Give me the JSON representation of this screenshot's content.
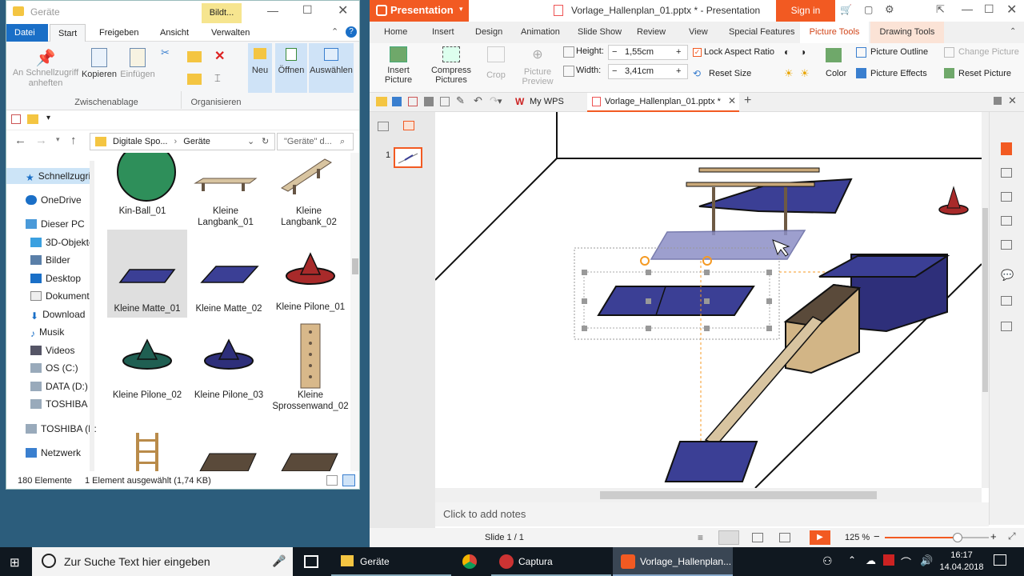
{
  "explorer": {
    "title": "Geräte",
    "picture_tools_badge": "Bildt...",
    "tabs": [
      "Datei",
      "Start",
      "Freigeben",
      "Ansicht",
      "Verwalten"
    ],
    "ribbon": {
      "pin": "An Schnellzugriff anheften",
      "copy": "Kopieren",
      "paste": "Einfügen",
      "group_clipboard": "Zwischenablage",
      "group_organize": "Organisieren",
      "new": "Neu",
      "open": "Öffnen",
      "select": "Auswählen"
    },
    "breadcrumb": [
      "Digitale Spo...",
      "Geräte"
    ],
    "search_placeholder": "\"Geräte\" d...",
    "nav_items": [
      "Schnellzugri",
      "OneDrive",
      "Dieser PC",
      "3D-Objekte",
      "Bilder",
      "Desktop",
      "Dokument",
      "Download",
      "Musik",
      "Videos",
      "OS (C:)",
      "DATA (D:)",
      "TOSHIBA (",
      "TOSHIBA (F:",
      "Netzwerk"
    ],
    "files": [
      "Kin-Ball_01",
      "Kleine Langbank_01",
      "Kleine Langbank_02",
      "Kleine Matte_01",
      "Kleine Matte_02",
      "Kleine Pilone_01",
      "Kleine Pilone_02",
      "Kleine Pilone_03",
      "Kleine Sprossenwand_02"
    ],
    "status_count": "180 Elemente",
    "status_selected": "1 Element ausgewählt (1,74 KB)"
  },
  "wps": {
    "app_button": "Presentation",
    "doc_title": "Vorlage_Hallenplan_01.pptx * - Presentation",
    "sign_in": "Sign in",
    "tabs": [
      "Home",
      "Insert",
      "Design",
      "Animation",
      "Slide Show",
      "Review",
      "View",
      "Special Features",
      "Picture Tools",
      "Drawing Tools"
    ],
    "ribbon": {
      "insert_picture": "Insert Picture",
      "compress": "Compress Pictures",
      "crop": "Crop",
      "picture_preview": "Picture Preview",
      "height_label": "Height:",
      "height_value": "1,55cm",
      "width_label": "Width:",
      "width_value": "3,41cm",
      "lock_ratio": "Lock Aspect Ratio",
      "reset_size": "Reset Size",
      "color": "Color",
      "picture_outline": "Picture Outline",
      "picture_effects": "Picture Effects",
      "change_picture": "Change Picture",
      "reset_picture": "Reset Picture"
    },
    "doc_tabs": [
      "My WPS",
      "Vorlage_Hallenplan_01.pptx *"
    ],
    "slide_number": "1",
    "notes_placeholder": "Click to add notes",
    "status_slide": "Slide 1 / 1",
    "zoom": "125 %",
    "zoom_fraction": 0.7
  },
  "taskbar": {
    "search_placeholder": "Zur Suche Text hier eingeben",
    "items": [
      "Geräte",
      "Captura",
      "Vorlage_Hallenplan..."
    ],
    "time": "16:17",
    "date": "14.04.2018"
  },
  "colors": {
    "wps_orange": "#f25a22",
    "mat_blue": "#3b3f95",
    "windows_blue": "#1a6fc7"
  }
}
